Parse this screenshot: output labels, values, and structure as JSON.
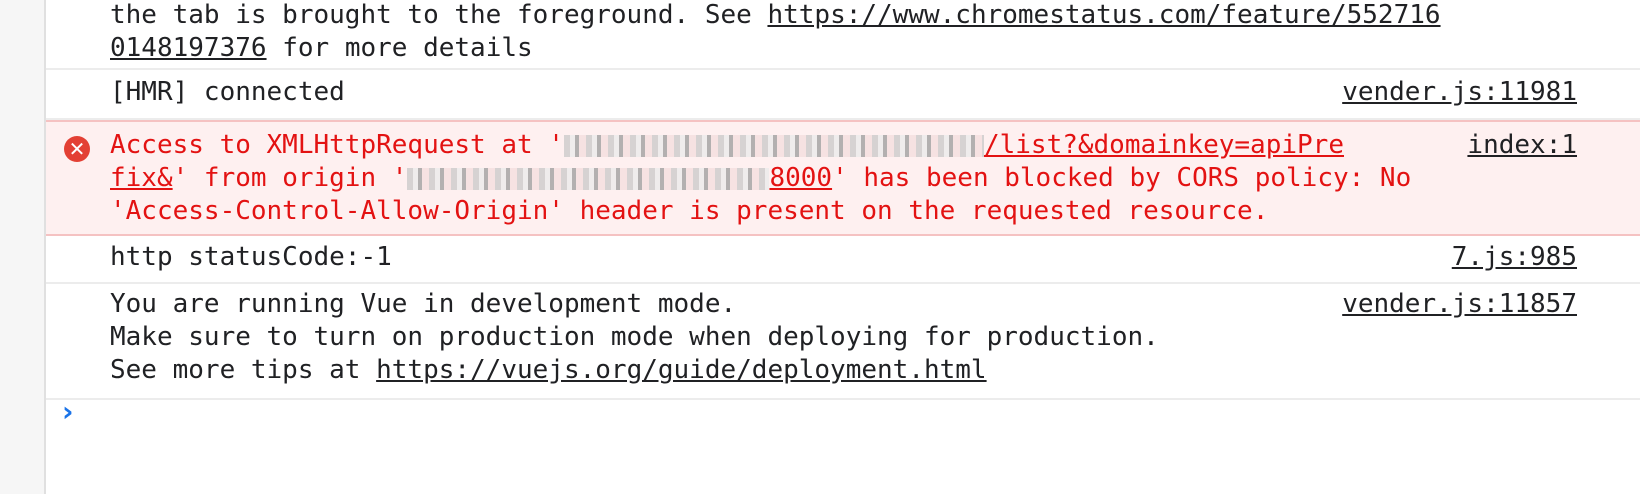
{
  "messages": {
    "row1": {
      "line1_prefix": "the tab is brought to the foreground. See ",
      "line1_link": "https://www.chromestatus.com/feature/552716",
      "line2_link": "0148197376",
      "line2_suffix": " for more details"
    },
    "hmr": {
      "text": "[HMR] connected",
      "source": "vender.js:11981"
    },
    "error": {
      "icon": "error-circle-icon",
      "line1_a": "Access to XMLHttpRequest at '",
      "line1_link": "/list?&domainkey=apiPre",
      "line2_link_a": "fix&",
      "line2_a": "' from origin '",
      "line2_link_b": "8000",
      "line2_b": "' has been blocked by CORS policy: No",
      "line3": "'Access-Control-Allow-Origin' header is present on the requested resource.",
      "source": "index:1"
    },
    "status": {
      "text": "http statusCode:-1",
      "source": "7.js:985"
    },
    "vue": {
      "line1": "You are running Vue in development mode.",
      "line2": "Make sure to turn on production mode when deploying for production.",
      "line3_prefix": "See more tips at ",
      "line3_link": "https://vuejs.org/guide/deployment.html",
      "source": "vender.js:11857"
    }
  },
  "prompt": {
    "icon": "chevron-right-icon",
    "glyph": "›"
  },
  "colors": {
    "error_text": "#e31212",
    "error_bg": "#fef0f0",
    "prompt": "#1a73e8"
  }
}
